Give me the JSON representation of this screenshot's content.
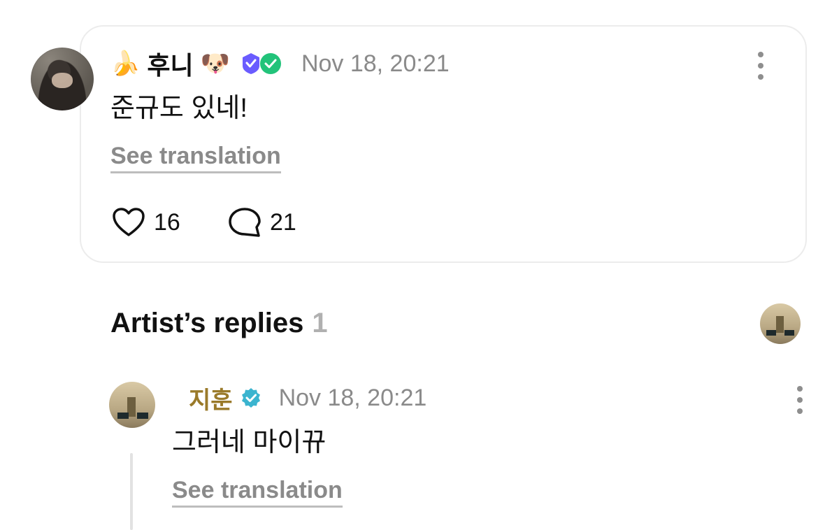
{
  "comment": {
    "author_emoji_left": "🍌",
    "author_name": "후니",
    "author_emoji_right": "🐶",
    "timestamp": "Nov 18, 20:21",
    "text": "준규도 있네!",
    "see_translation": "See translation",
    "likes": "16",
    "replies": "21"
  },
  "artist_replies": {
    "title": "Artist’s replies",
    "count": "1"
  },
  "reply": {
    "author_name": "지훈",
    "timestamp": "Nov 18, 20:21",
    "text": "그러네 마이뀨",
    "see_translation": "See translation"
  },
  "colors": {
    "accent_gold": "#9a7a2a",
    "muted": "#8a8a8a",
    "verified": "#3bb4cf",
    "badge_purple": "#6a5cff",
    "badge_green": "#22c37a"
  }
}
